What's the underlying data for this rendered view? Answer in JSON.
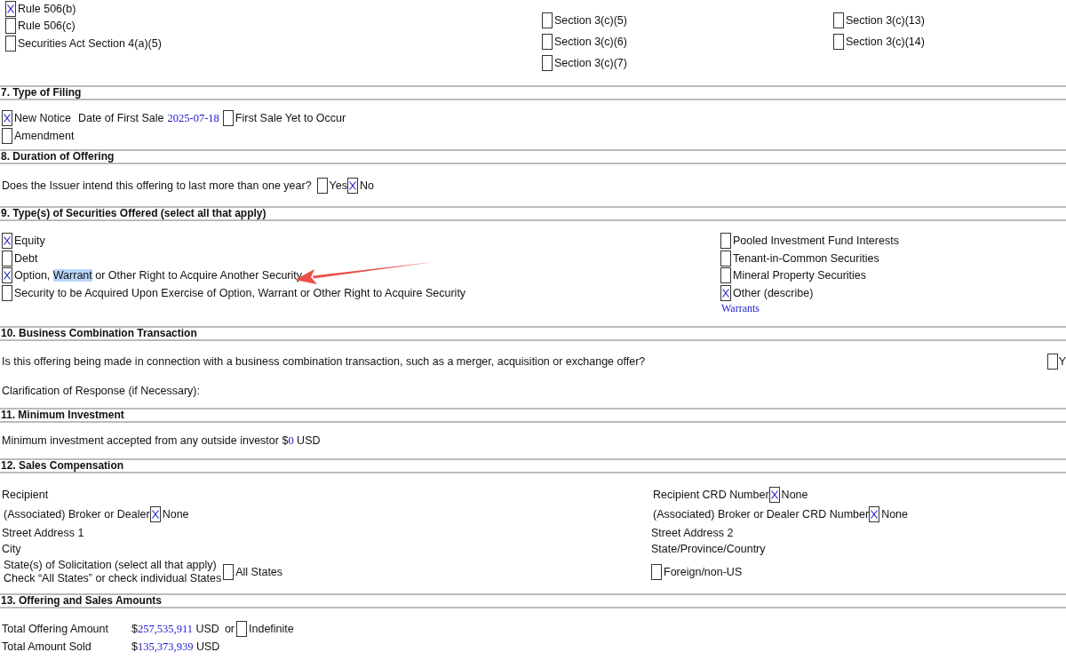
{
  "exemptions": {
    "columns": [
      [
        {
          "label": "Rule 506(b)",
          "checked": true
        },
        {
          "label": "Rule 506(c)",
          "checked": false
        },
        {
          "label": "Securities Act Section 4(a)(5)",
          "checked": false
        }
      ],
      [
        {
          "label": "Section 3(c)(5)",
          "checked": false
        },
        {
          "label": "Section 3(c)(6)",
          "checked": false
        },
        {
          "label": "Section 3(c)(7)",
          "checked": false
        }
      ],
      [
        {
          "label": "Section 3(c)(13)",
          "checked": false
        },
        {
          "label": "Section 3(c)(14)",
          "checked": false
        }
      ]
    ]
  },
  "type_of_filing": {
    "title": "7. Type of Filing",
    "new_notice": {
      "label": "New Notice",
      "checked": true
    },
    "date_label": "Date of First Sale",
    "date_value": "2025-07-18",
    "yet_to_occur": {
      "label": "First Sale Yet to Occur",
      "checked": false
    },
    "amendment": {
      "label": "Amendment",
      "checked": false
    }
  },
  "duration": {
    "title": "8. Duration of Offering",
    "question": "Does the Issuer intend this offering to last more than one year?",
    "options": [
      {
        "label": "Yes",
        "checked": false
      },
      {
        "label": "No",
        "checked": true
      }
    ]
  },
  "securities": {
    "title": "9. Type(s) of Securities Offered (select all that apply)",
    "left": [
      {
        "checked": true,
        "label_parts": [
          {
            "text": "Equity",
            "selected": false
          }
        ]
      },
      {
        "checked": false,
        "label_parts": [
          {
            "text": "Debt",
            "selected": false
          }
        ]
      },
      {
        "checked": true,
        "label_parts": [
          {
            "text": "Option, ",
            "selected": false
          },
          {
            "text": "Warrant",
            "selected": true
          },
          {
            "text": " or Other Right to Acquire Another Security",
            "selected": false
          }
        ]
      },
      {
        "checked": false,
        "label_parts": [
          {
            "text": "Security to be Acquired Upon Exercise of Option, Warrant or Other Right to Acquire Security",
            "selected": false
          }
        ]
      }
    ],
    "right": [
      {
        "label": "Pooled Investment Fund Interests",
        "checked": false
      },
      {
        "label": "Tenant-in-Common Securities",
        "checked": false
      },
      {
        "label": "Mineral Property Securities",
        "checked": false
      },
      {
        "label": "Other (describe)",
        "checked": true
      }
    ],
    "other_description": "Warrants"
  },
  "business_combination": {
    "title": "10. Business Combination Transaction",
    "question": "Is this offering being made in connection with a business combination transaction, such as a merger, acquisition or exchange offer?",
    "options": [
      {
        "label": "Y",
        "checked": false
      }
    ],
    "clarification_label": "Clarification of Response (if Necessary):"
  },
  "minimum_investment": {
    "title": "11. Minimum Investment",
    "label": "Minimum investment accepted from any outside investor $",
    "value": "0",
    "unit": "USD"
  },
  "sales_compensation": {
    "title": "12. Sales Compensation",
    "left": [
      {
        "kind": "text",
        "label": "Recipient"
      },
      {
        "kind": "check",
        "label": "(Associated) Broker or Dealer",
        "option": {
          "label": "None",
          "checked": true
        }
      },
      {
        "kind": "text",
        "label": "Street Address 1"
      },
      {
        "kind": "text",
        "label": "City"
      },
      {
        "kind": "states",
        "lines": [
          "State(s) of Solicitation (select all that apply)",
          "Check “All States” or check individual States"
        ],
        "option": {
          "label": "All States",
          "checked": false
        }
      }
    ],
    "right": [
      {
        "kind": "check",
        "label": "Recipient CRD Number",
        "option": {
          "label": "None",
          "checked": true
        }
      },
      {
        "kind": "check",
        "label": "(Associated) Broker or Dealer CRD Number",
        "option": {
          "label": "None",
          "checked": true
        }
      },
      {
        "kind": "text",
        "label": "Street Address 2"
      },
      {
        "kind": "text",
        "label": "State/Province/Country"
      },
      {
        "kind": "option",
        "option": {
          "label": "Foreign/non-US",
          "checked": false
        }
      }
    ]
  },
  "offering_amounts": {
    "title": "13. Offering and Sales Amounts",
    "rows": [
      {
        "label": "Total Offering Amount",
        "currency_sign": "$",
        "value": "257,535,911",
        "unit": "USD",
        "connector": "or",
        "option": {
          "label": "Indefinite",
          "checked": false
        }
      },
      {
        "label": "Total Amount Sold",
        "currency_sign": "$",
        "value": "135,373,939",
        "unit": "USD"
      }
    ]
  }
}
